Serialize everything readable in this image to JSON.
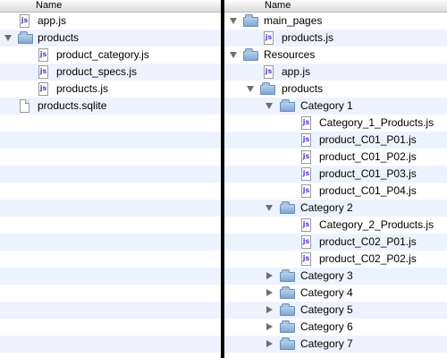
{
  "left_pane": {
    "column_header": "Name",
    "items": [
      {
        "label": "app.js",
        "icon": "js-file-icon"
      },
      {
        "label": "products",
        "icon": "folder-icon",
        "expanded": true
      },
      {
        "label": "product_category.js",
        "icon": "js-file-icon"
      },
      {
        "label": "product_specs.js",
        "icon": "js-file-icon"
      },
      {
        "label": "products.js",
        "icon": "js-file-icon"
      },
      {
        "label": "products.sqlite",
        "icon": "document-icon"
      }
    ]
  },
  "right_pane": {
    "column_header": "Name",
    "items": [
      {
        "label": "main_pages",
        "icon": "folder-icon",
        "expanded": true
      },
      {
        "label": "products.js",
        "icon": "js-file-icon"
      },
      {
        "label": "Resources",
        "icon": "folder-icon",
        "expanded": true
      },
      {
        "label": "app.js",
        "icon": "js-file-icon"
      },
      {
        "label": "products",
        "icon": "folder-icon",
        "expanded": true
      },
      {
        "label": "Category 1",
        "icon": "folder-icon",
        "expanded": true
      },
      {
        "label": "Category_1_Products.js",
        "icon": "js-file-icon"
      },
      {
        "label": "product_C01_P01.js",
        "icon": "js-file-icon"
      },
      {
        "label": "product_C01_P02.js",
        "icon": "js-file-icon"
      },
      {
        "label": "product_C01_P03.js",
        "icon": "js-file-icon"
      },
      {
        "label": "product_C01_P04.js",
        "icon": "js-file-icon"
      },
      {
        "label": "Category 2",
        "icon": "folder-icon",
        "expanded": true
      },
      {
        "label": "Category_2_Products.js",
        "icon": "js-file-icon"
      },
      {
        "label": "product_C02_P01.js",
        "icon": "js-file-icon"
      },
      {
        "label": "product_C02_P02.js",
        "icon": "js-file-icon"
      },
      {
        "label": "Category 3",
        "icon": "folder-icon",
        "expanded": false
      },
      {
        "label": "Category 4",
        "icon": "folder-icon",
        "expanded": false
      },
      {
        "label": "Category 5",
        "icon": "folder-icon",
        "expanded": false
      },
      {
        "label": "Category 6",
        "icon": "folder-icon",
        "expanded": false
      },
      {
        "label": "Category 7",
        "icon": "folder-icon",
        "expanded": false
      }
    ]
  },
  "js_icon_glyph": "js",
  "colors": {
    "stripe_alt": "#edf3fe",
    "folder": "#7fa7d3",
    "js_glyph": "#5436c7",
    "divider": "#000000"
  }
}
